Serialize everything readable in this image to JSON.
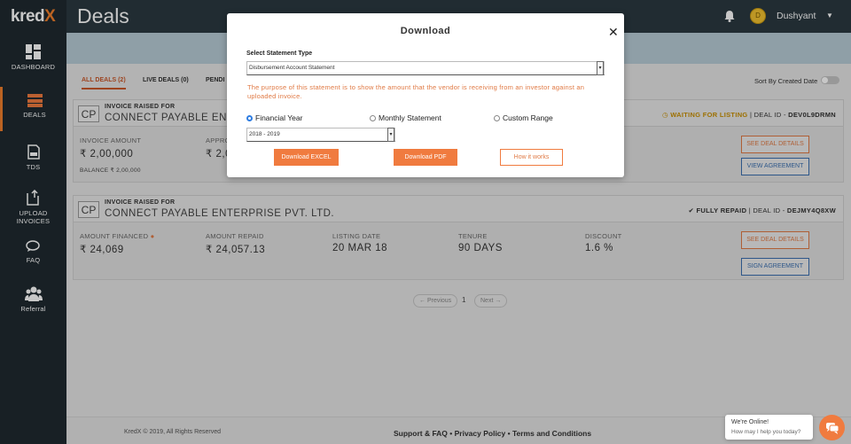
{
  "app": {
    "logo_main": "kred",
    "logo_accent": "X",
    "page_title": "Deals"
  },
  "header": {
    "avatar_initial": "D",
    "user_name": "Dushyant"
  },
  "sidebar": {
    "items": [
      {
        "label": "DASHBOARD",
        "icon": "dashboard-grid-icon"
      },
      {
        "label": "DEALS",
        "icon": "deals-icon",
        "active": true
      },
      {
        "label": "TDS",
        "icon": "tds-document-icon"
      },
      {
        "label": "UPLOAD",
        "label2": "INVOICES",
        "icon": "upload-invoice-icon"
      },
      {
        "label": "FAQ",
        "icon": "chat-icon"
      },
      {
        "label": "Referral",
        "icon": "people-icon"
      }
    ]
  },
  "tabs": {
    "all": "ALL DEALS (2)",
    "live": "LIVE DEALS (0)",
    "pending": "PENDI"
  },
  "sort": {
    "label": "Sort By Created Date"
  },
  "deals": [
    {
      "initials": "CP",
      "raised_for": "INVOICE RAISED FOR",
      "company": "CONNECT PAYABLE ENTERP",
      "status": "WAITING FOR LISTING",
      "deal_id_label": "| DEAL ID -",
      "deal_id": "DEV0L9DRMN",
      "col1_label": "INVOICE AMOUNT",
      "col1_value": "₹ 2,00,000",
      "col2_label": "APPRO",
      "col2_value": "₹ 2,0",
      "balance": "BALANCE  ₹ 2,00,000",
      "btn1": "SEE DEAL DETAILS",
      "btn2": "VIEW AGREEMENT"
    },
    {
      "initials": "CP",
      "raised_for": "INVOICE RAISED FOR",
      "company": "CONNECT PAYABLE ENTERPRISE PVT. LTD.",
      "status": "FULLY REPAID",
      "deal_id_label": "| DEAL ID -",
      "deal_id": "DEJMY4Q8XW",
      "columns": [
        {
          "label": "AMOUNT FINANCED",
          "value": "₹ 24,069"
        },
        {
          "label": "AMOUNT REPAID",
          "value": "₹ 24,057.13"
        },
        {
          "label": "LISTING DATE",
          "value": "20 MAR 18"
        },
        {
          "label": "TENURE",
          "value": "90 DAYS"
        },
        {
          "label": "DISCOUNT",
          "value": "1.6 %"
        }
      ],
      "btn1": "SEE DEAL DETAILS",
      "btn2": "SIGN AGREEMENT"
    }
  ],
  "pager": {
    "prev": "← Previous",
    "page": "1",
    "next": "Next →"
  },
  "footer": {
    "copyright": "KredX © 2019, All Rights Reserved",
    "links": "Support & FAQ  •  Privacy Policy  •  Terms and Conditions"
  },
  "modal": {
    "title": "Download",
    "close": "✕",
    "statement_type_label": "Select Statement Type",
    "statement_type_value": "Disbursement Account Statement",
    "note": "The purpose of this statement is to show the amount that the vendor is receiving from an investor against an uploaded invoice.",
    "radio_financial_year": "Financial Year",
    "radio_monthly": "Monthly Statement",
    "radio_custom": "Custom Range",
    "year_value": "2018 - 2019",
    "btn_excel": "Download EXCEL",
    "btn_pdf": "Download PDF",
    "btn_how": "How it works"
  },
  "chat": {
    "line1": "We're Online!",
    "line2": "How may I help you today?"
  },
  "colors": {
    "accent": "#f07b3f",
    "sidebar": "#1f2a30",
    "link_blue": "#3a6fb0"
  }
}
